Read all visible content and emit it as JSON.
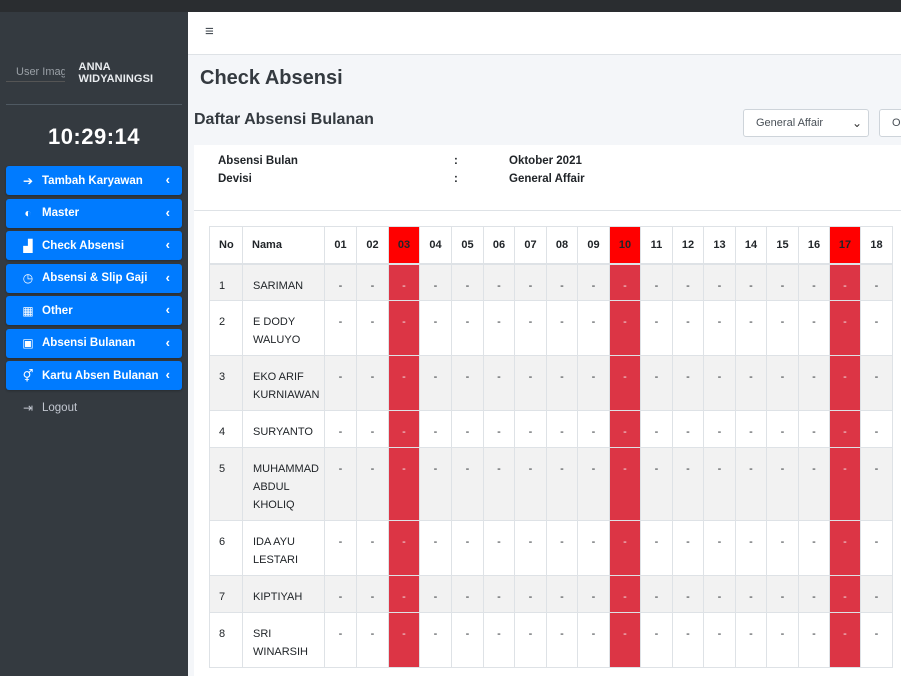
{
  "sidebar": {
    "user_image_alt": "User Image",
    "user_name": "ANNA WIDYANINGSI",
    "clock": "10:29:14",
    "items": [
      {
        "label": "Tambah Karyawan",
        "icon": "sign-in-icon",
        "glyph": "➔"
      },
      {
        "label": "Master",
        "icon": "dashboard-icon",
        "glyph": "◐"
      },
      {
        "label": "Check Absensi",
        "icon": "signal-icon",
        "glyph": "▟"
      },
      {
        "label": "Absensi & Slip Gaji",
        "icon": "clock-icon",
        "glyph": "◷"
      },
      {
        "label": "Other",
        "icon": "table-icon",
        "glyph": "▦"
      },
      {
        "label": "Absensi Bulanan",
        "icon": "id-badge-icon",
        "glyph": "▣"
      },
      {
        "label": "Kartu Absen Bulanan",
        "icon": "transgender-icon",
        "glyph": "⚥"
      }
    ],
    "logout_label": "Logout",
    "logout_glyph": "⇥"
  },
  "header": {
    "menu_glyph": "≡"
  },
  "page": {
    "title": "Check Absensi",
    "subtitle": "Daftar Absensi Bulanan",
    "department_select": "General Affair",
    "button_partial": "O"
  },
  "info": {
    "month_label": "Absensi Bulan",
    "month_value": "Oktober 2021",
    "division_label": "Devisi",
    "division_value": "General Affair",
    "colon": ":"
  },
  "table": {
    "headers": [
      "No",
      "Nama",
      "01",
      "02",
      "03",
      "04",
      "05",
      "06",
      "07",
      "08",
      "09",
      "10",
      "11",
      "12",
      "13",
      "14",
      "15",
      "16",
      "17",
      "18"
    ],
    "red_days": [
      "03",
      "10",
      "17"
    ],
    "rows": [
      {
        "no": "1",
        "name": [
          "SARIMAN"
        ]
      },
      {
        "no": "2",
        "name": [
          "E DODY",
          "WALUYO"
        ]
      },
      {
        "no": "3",
        "name": [
          "EKO ARIF",
          "KURNIAWAN"
        ]
      },
      {
        "no": "4",
        "name": [
          "SURYANTO"
        ]
      },
      {
        "no": "5",
        "name": [
          "MUHAMMAD",
          "ABDUL",
          "KHOLIQ"
        ]
      },
      {
        "no": "6",
        "name": [
          "IDA AYU",
          "LESTARI"
        ]
      },
      {
        "no": "7",
        "name": [
          "KIPTIYAH"
        ]
      },
      {
        "no": "8",
        "name": [
          "SRI",
          "WINARSIH"
        ]
      }
    ],
    "empty_cell": "-"
  },
  "colors": {
    "sidebar_bg": "#343a40",
    "nav_active": "#007bff",
    "weekend_header": "#ff0000",
    "weekend_cell": "#dc3545"
  }
}
